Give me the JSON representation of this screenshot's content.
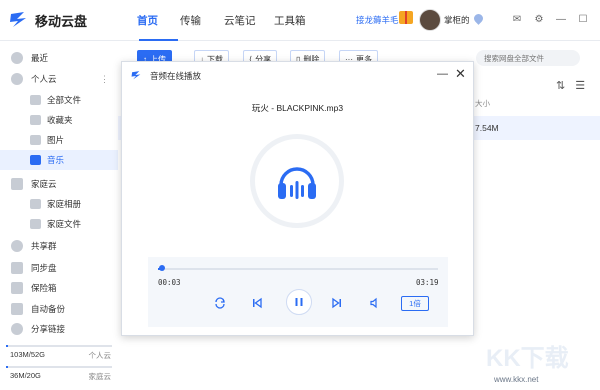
{
  "app": {
    "title": "移动云盘"
  },
  "nav": {
    "tabs": [
      "首页",
      "传输",
      "云笔记",
      "工具箱"
    ],
    "active": "首页"
  },
  "header": {
    "promo": "接龙薅羊毛",
    "username": "掌柜的"
  },
  "sidebar": {
    "recent": "最近",
    "personal_cloud": "个人云",
    "items": [
      "全部文件",
      "收藏夹",
      "图片",
      "音乐"
    ],
    "family_cloud": "家庭云",
    "family_items": [
      "家庭相册",
      "家庭文件"
    ],
    "groups": [
      "共享群",
      "同步盘",
      "保险箱",
      "自动备份",
      "分享链接"
    ],
    "storage": [
      {
        "used": "103M/52G",
        "label": "个人云",
        "fraction": 0.002
      },
      {
        "used": "36M/20G",
        "label": "家庭云",
        "fraction": 0.002
      }
    ]
  },
  "toolbar": {
    "upload": "上传",
    "download": "下载",
    "share": "分享",
    "delete": "删除",
    "more": "更多"
  },
  "search": {
    "placeholder": "搜索网盘全部文件"
  },
  "list": {
    "size_header": "大小",
    "size_value": "7.54M"
  },
  "watermark": {
    "text": "KK下载",
    "url": "www.kkx.net"
  },
  "dialog": {
    "title": "音频在线播放",
    "track": "玩火 - BLACKPINK.mp3",
    "time_current": "00:03",
    "time_total": "03:19",
    "progress": 0.015,
    "speed": "1倍"
  },
  "colors": {
    "accent": "#2b6cf3"
  }
}
